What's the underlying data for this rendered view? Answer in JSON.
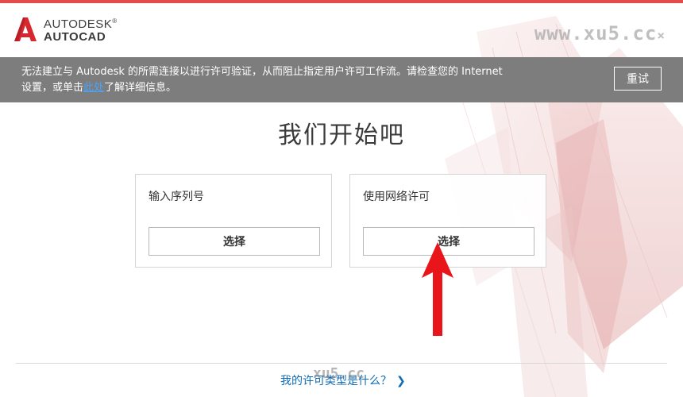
{
  "header": {
    "logo_line1": "AUTODESK",
    "logo_line1_mark": "®",
    "logo_line2": "AUTOCAD",
    "watermark": "www.xu5.cc",
    "watermark_mark": "×"
  },
  "notice": {
    "text_part1": "无法建立与 Autodesk 的所需连接以进行许可验证，从而阻止指定用户许可工作流。请检查您的 Internet 设置，或单击",
    "link_text": "此处",
    "text_part2": "了解详细信息。",
    "retry_label": "重试"
  },
  "main": {
    "title": "我们开始吧",
    "options": [
      {
        "label": "输入序列号",
        "button_label": "选择"
      },
      {
        "label": "使用网络许可",
        "button_label": "选择"
      }
    ]
  },
  "footer": {
    "link_text": "我的许可类型是什么？",
    "chevron": "❯",
    "watermark": "xu5.cc"
  },
  "colors": {
    "accent_red": "#e44b4b",
    "notice_bg": "#7d7d7d",
    "link_blue": "#0d6ab5",
    "annotation_red": "#e8161b"
  },
  "icons": {
    "logo": "autocad-a-logo-icon",
    "footer_chevron": "chevron-right-icon",
    "annotation": "red-arrow-up-icon"
  }
}
